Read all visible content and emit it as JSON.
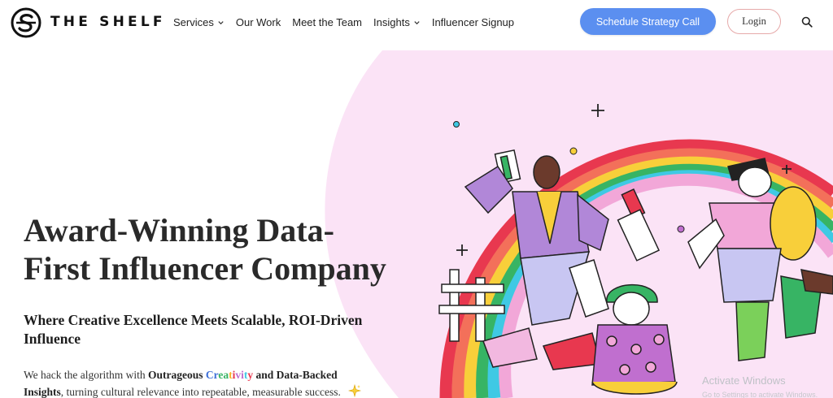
{
  "brand": {
    "name": "THE SHELF",
    "logo_icon": "shelf-s-logo-icon"
  },
  "nav": {
    "items": [
      {
        "label": "Services",
        "has_dropdown": true
      },
      {
        "label": "Our Work",
        "has_dropdown": false
      },
      {
        "label": "Meet the Team",
        "has_dropdown": false
      },
      {
        "label": "Insights",
        "has_dropdown": true
      },
      {
        "label": "Influencer Signup",
        "has_dropdown": false
      }
    ],
    "cta_label": "Schedule Strategy Call",
    "login_label": "Login",
    "search_icon": "search-icon"
  },
  "hero": {
    "headline_line1": "Award-Winning Data-",
    "headline_line2": "First Influencer Company",
    "subhead_line1": "Where Creative Excellence Meets Scalable, ROI-Driven",
    "subhead_line2": "Influence",
    "body_prefix": "We hack the algorithm with ",
    "body_bold1": "Outrageous ",
    "body_rainbow": "Creativity",
    "body_bold2": " and Data-Backed",
    "body_bold3": "Insights",
    "body_suffix": ", turning cultural relevance into repeatable, measurable success.",
    "sparkle_icon": "sparkles-icon",
    "accent_colors": {
      "pink_bg": "#fbe3f6",
      "cta_blue": "#5b8ff0"
    },
    "illustration": "rainbow-characters-illustration"
  },
  "os_overlay": {
    "title": "Activate Windows",
    "subtitle": "Go to Settings to activate Windows."
  }
}
